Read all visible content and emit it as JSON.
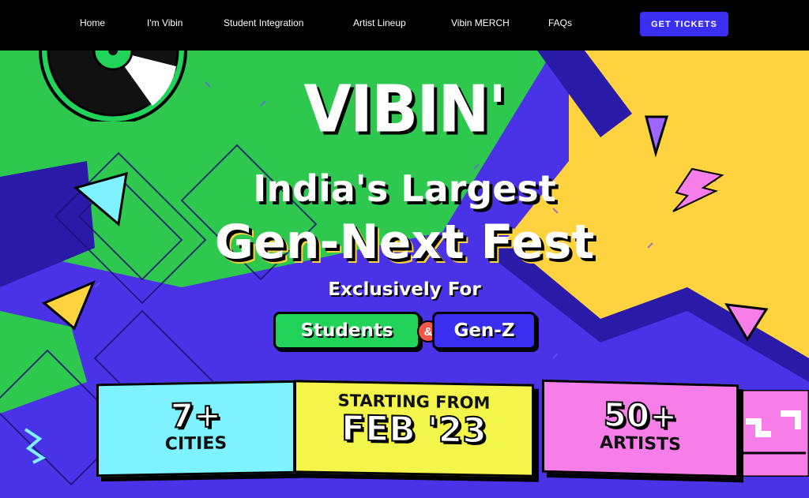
{
  "nav": {
    "items": [
      {
        "label": "Home"
      },
      {
        "label": "I'm Vibin"
      },
      {
        "label": "Student Integration"
      },
      {
        "label": "Artist Lineup"
      },
      {
        "label": "Vibin MERCH"
      },
      {
        "label": "FAQs"
      }
    ],
    "cta_label": "GET TICKETS"
  },
  "hero": {
    "brand": "VIBIN'",
    "line1": "India's Largest",
    "line2": "Gen-Next Fest",
    "exclusive": "Exclusively For",
    "audience": {
      "left": "Students",
      "amp": "&",
      "right": "Gen-Z"
    }
  },
  "stats": [
    {
      "value": "7+",
      "label": "CITIES"
    },
    {
      "value": "FEB '23",
      "label": "STARTING FROM"
    },
    {
      "value": "50+",
      "label": "ARTISTS"
    }
  ],
  "colors": {
    "nav_bg": "#000000",
    "cta": "#3a2ff0",
    "green": "#22d35a",
    "purple": "#4a33e6",
    "yellow": "#ffd23f",
    "cyan": "#7ef3ff",
    "lime": "#f4f54b",
    "pink": "#f77ee8"
  },
  "icons": [
    "vinyl-record-icon",
    "lightning-bolt-icon",
    "triangle-icon",
    "zigzag-icon"
  ]
}
